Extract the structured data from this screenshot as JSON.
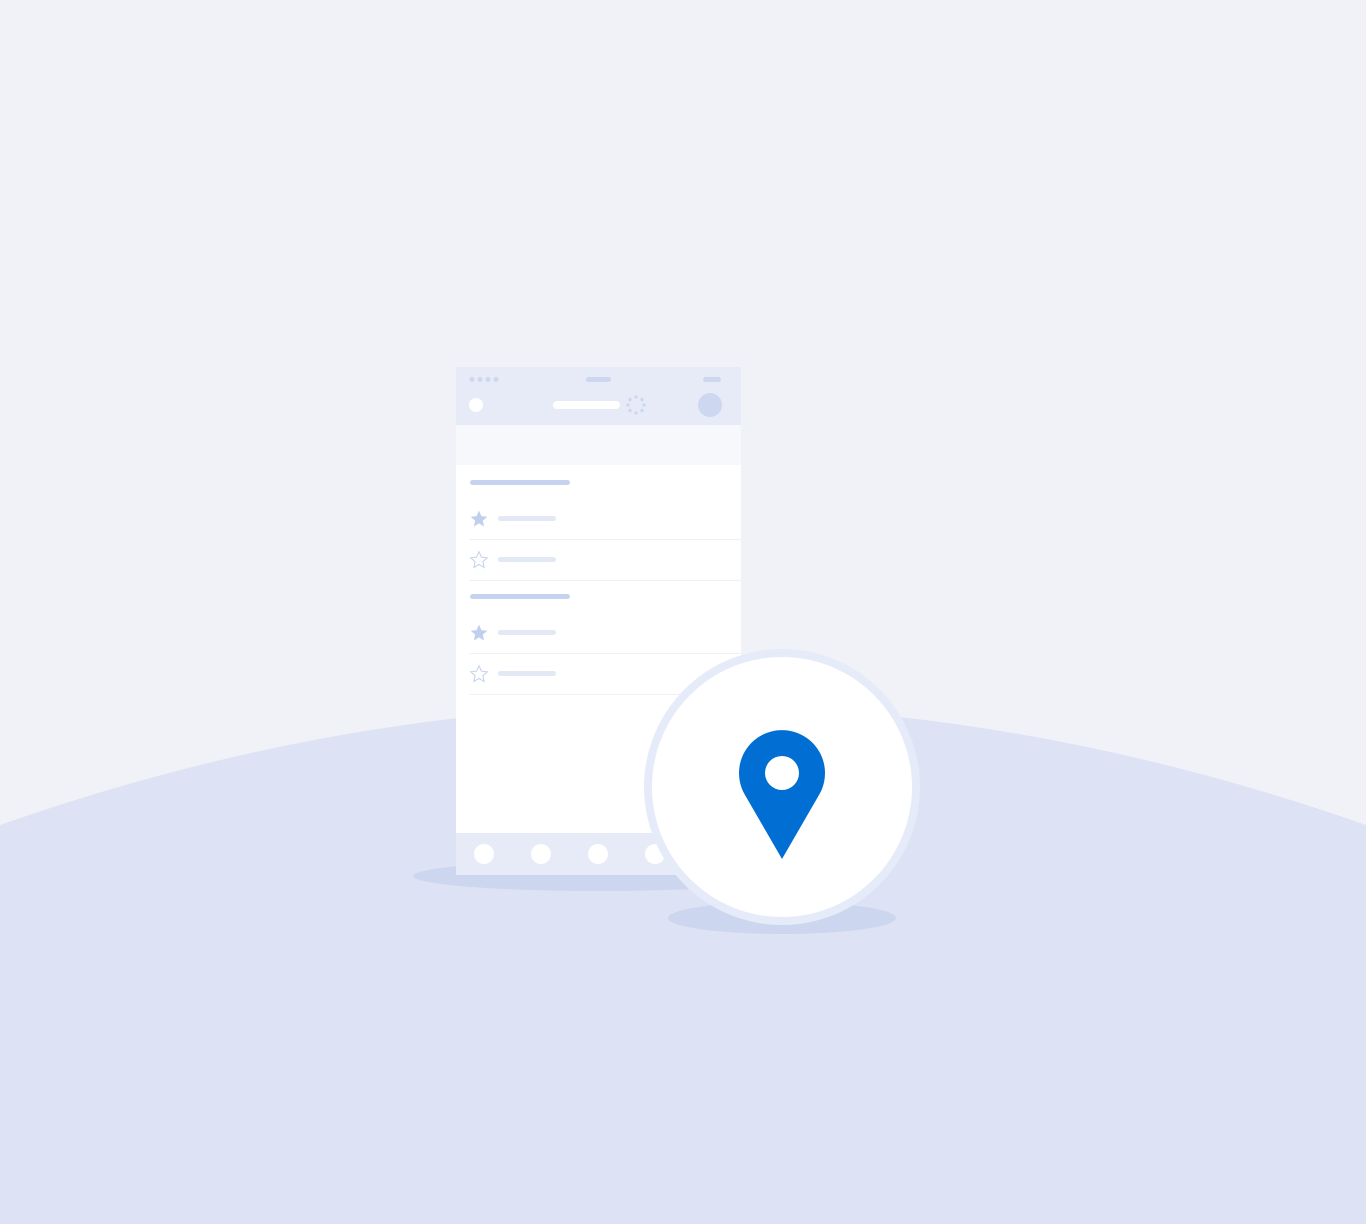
{
  "illustration": {
    "subject": "phone-with-location-pin",
    "colors": {
      "background": "#f0f2f7",
      "ground": "#dde3f4",
      "phone_chrome": "#e6ebf7",
      "placeholder_line": "#c6d3ef",
      "placeholder_light": "#e2e8f4",
      "pin": "#006ed2",
      "badge_ring": "#e5ebf8"
    },
    "icons": [
      "star-filled-icon",
      "star-outline-icon",
      "location-pin-icon",
      "spinner-icon"
    ],
    "list_sections": [
      {
        "rows": [
          {
            "starred": true
          },
          {
            "starred": false
          }
        ]
      },
      {
        "rows": [
          {
            "starred": true
          },
          {
            "starred": false
          }
        ]
      }
    ],
    "tab_count": 4
  }
}
